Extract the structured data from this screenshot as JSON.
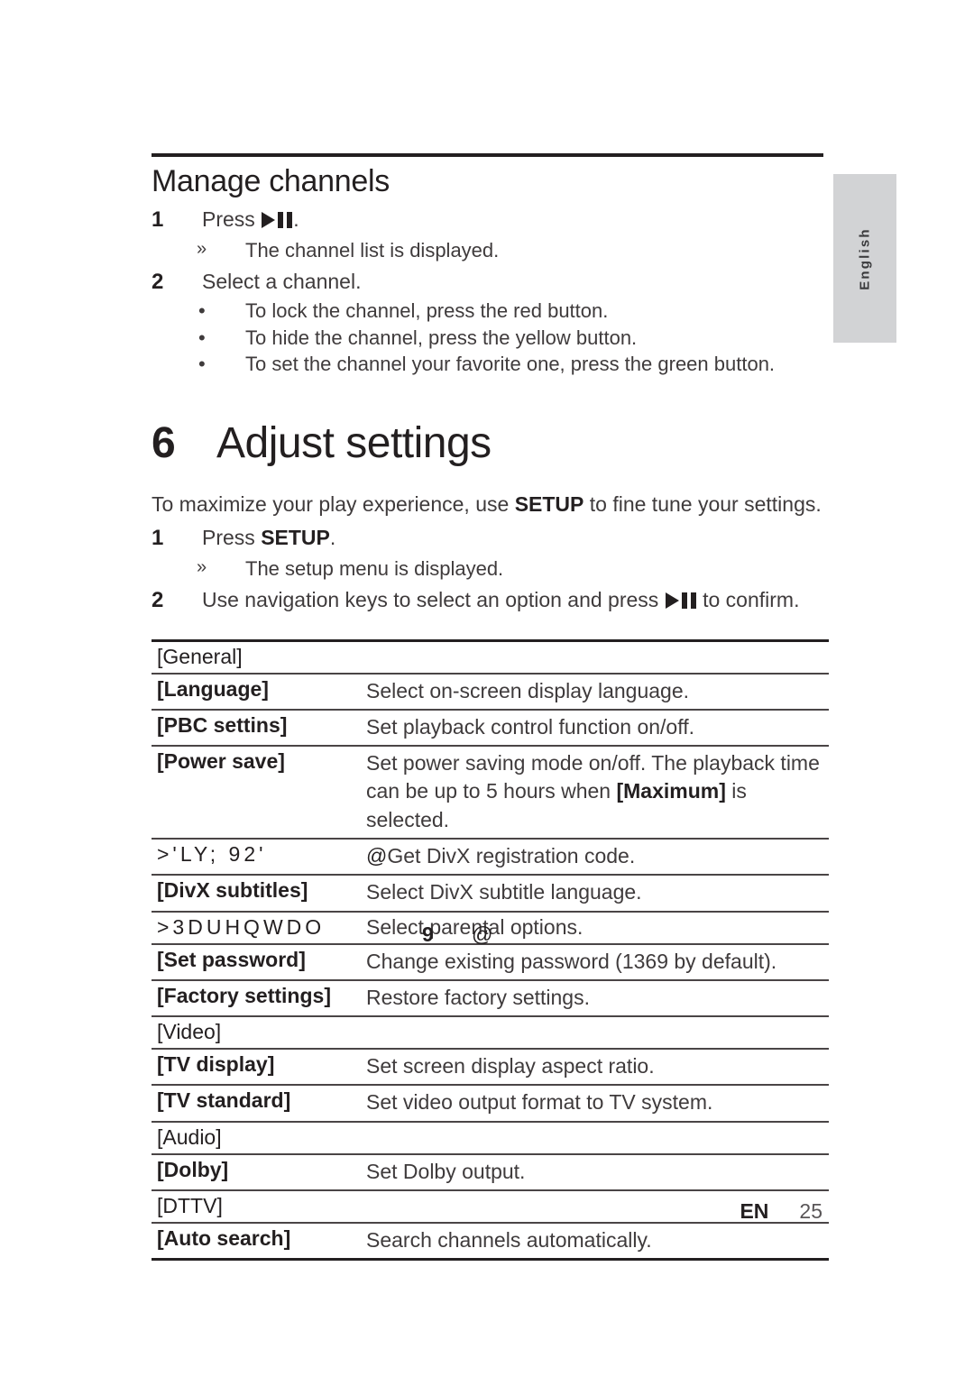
{
  "side_tab": {
    "language_label": "English"
  },
  "manage_channels": {
    "title": "Manage channels",
    "steps": [
      {
        "num": "1",
        "text_before": "Press ",
        "icon": "play-pause-icon",
        "text_after": ".",
        "results": [
          {
            "marker": "»",
            "text": "The channel list is displayed."
          }
        ]
      },
      {
        "num": "2",
        "text_before": "Select a channel.",
        "bullets": [
          {
            "marker": "•",
            "text": "To lock the channel, press the red button."
          },
          {
            "marker": "•",
            "text": "To hide the channel, press the yellow button."
          },
          {
            "marker": "•",
            "text": "To set the channel your favorite one, press the green button."
          }
        ]
      }
    ]
  },
  "chapter": {
    "number": "6",
    "title": "Adjust settings",
    "intro_part1": "To maximize your play experience, use ",
    "intro_bold": "SETUP",
    "intro_part2": " to fine tune your settings.",
    "steps": [
      {
        "num": "1",
        "text_before": "Press ",
        "bold": "SETUP",
        "text_after": ".",
        "results": [
          {
            "marker": "»",
            "text": "The setup menu is displayed."
          }
        ]
      },
      {
        "num": "2",
        "text_before": "Use navigation keys to select an option and press ",
        "icon": "play-pause-icon",
        "text_after": " to confirm."
      }
    ]
  },
  "settings_table": {
    "rows": [
      {
        "kind": "group",
        "name": "[General]",
        "desc": ""
      },
      {
        "kind": "item",
        "name": "[Language]",
        "desc": "Select on-screen display language."
      },
      {
        "kind": "item",
        "name": "[PBC settins]",
        "desc": "Set playback control function on/off."
      },
      {
        "kind": "item",
        "name": "[Power save]",
        "desc_line1": "Set power saving mode on/off. The playback time",
        "desc_line2_pre": "can be up to 5 hours when ",
        "desc_line2_bold": "[Maximum]",
        "desc_line2_post": " is selected."
      },
      {
        "kind": "mojibake",
        "name": ">'LY;  92'",
        "at": "@",
        "desc": "Get DivX registration code."
      },
      {
        "kind": "item",
        "name": "[DivX subtitles]",
        "desc": "Select DivX subtitle language."
      },
      {
        "kind": "mojibake-overlap",
        "name": ">3DUHQWDO",
        "overlay_bold": "9",
        "overlay_at": "@",
        "desc": "Select parental options."
      },
      {
        "kind": "item",
        "name": "[Set password]",
        "desc": "Change existing password (1369 by default)."
      },
      {
        "kind": "item",
        "name": "[Factory settings]",
        "desc": "Restore factory settings."
      },
      {
        "kind": "group",
        "name": "[Video]",
        "desc": ""
      },
      {
        "kind": "item",
        "name": "[TV display]",
        "desc": "Set screen display aspect ratio."
      },
      {
        "kind": "item",
        "name": "[TV standard]",
        "desc": "Set video output format to TV system."
      },
      {
        "kind": "group",
        "name": "[Audio]",
        "desc": ""
      },
      {
        "kind": "item",
        "name": "[Dolby]",
        "desc": "Set Dolby output."
      },
      {
        "kind": "group",
        "name": "[DTTV]",
        "desc": ""
      },
      {
        "kind": "item",
        "name": "[Auto search]",
        "desc": "Search channels automatically."
      }
    ]
  },
  "footer": {
    "locale": "EN",
    "page_number": "25"
  }
}
